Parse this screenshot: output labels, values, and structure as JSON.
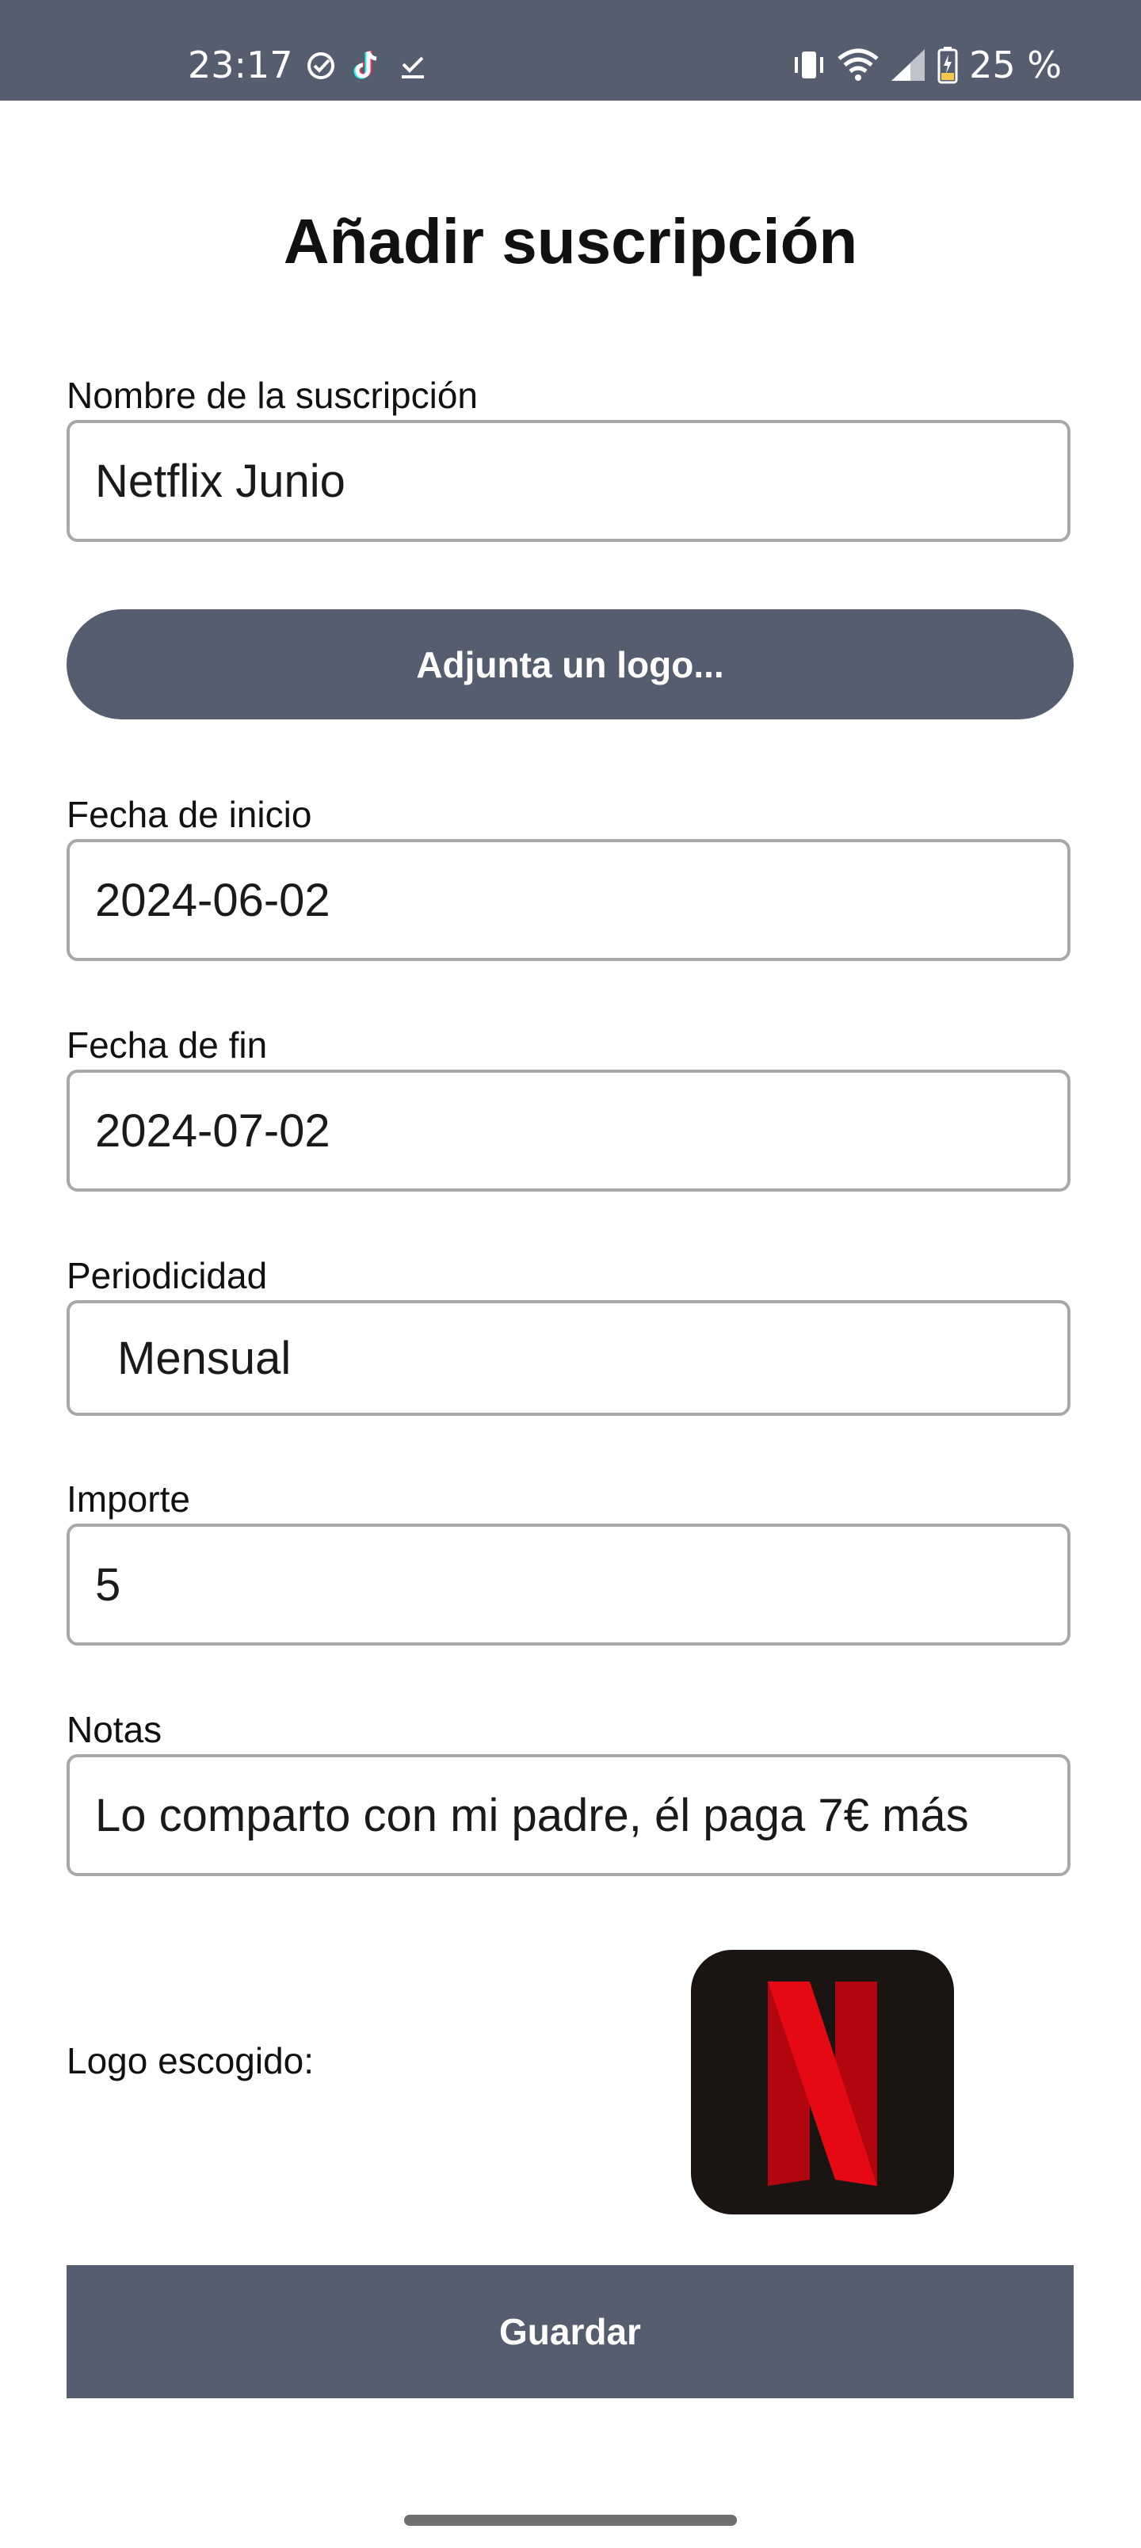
{
  "status_bar": {
    "time": "23:17",
    "battery_text": "25 %",
    "left_icons": [
      "check-circle-icon",
      "tiktok-icon",
      "download-done-icon"
    ],
    "right_icons": [
      "vibrate-icon",
      "wifi-icon",
      "signal-icon",
      "battery-charging-icon"
    ]
  },
  "form": {
    "title": "Añadir suscripción",
    "name_label": "Nombre de la suscripción",
    "name_value": "Netflix Junio",
    "attach_logo_label": "Adjunta un logo...",
    "start_date_label": "Fecha de inicio",
    "start_date_value": "2024-06-02",
    "end_date_label": "Fecha de fin",
    "end_date_value": "2024-07-02",
    "periodicity_label": "Periodicidad",
    "periodicity_value": "Mensual",
    "amount_label": "Importe",
    "amount_value": "5",
    "notes_label": "Notas",
    "notes_value": "Lo comparto con mi padre, él paga 7€ más",
    "chosen_logo_label": "Logo escogido:",
    "save_label": "Guardar"
  },
  "colors": {
    "primary": "#545e6e",
    "field_border": "#a8a8a8",
    "netflix_bg": "#1a1513",
    "netflix_red": "#e50914",
    "netflix_dark_red": "#b1060f"
  }
}
